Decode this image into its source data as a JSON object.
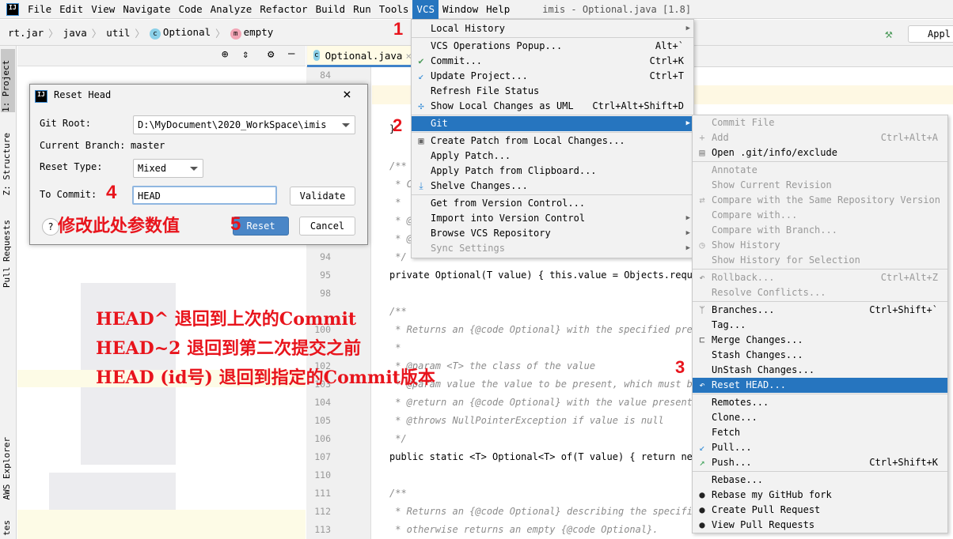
{
  "menubar": {
    "items": [
      "File",
      "Edit",
      "View",
      "Navigate",
      "Code",
      "Analyze",
      "Refactor",
      "Build",
      "Run",
      "Tools",
      "VCS",
      "Window",
      "Help"
    ],
    "active": "VCS",
    "window_title": "imis - Optional.java [1.8]"
  },
  "breadcrumb": [
    "rt.jar",
    "java",
    "util",
    "Optional",
    "empty"
  ],
  "run_config": "Appl",
  "side_tools": [
    "1: Project",
    "Z: Structure",
    "Pull Requests",
    "AWS Explorer",
    "tes"
  ],
  "editor": {
    "tab": "Optional.java",
    "lines": [
      {
        "n": "84",
        "t": ""
      },
      {
        "n": "",
        "t": "}"
      },
      {
        "n": "",
        "t": "/**"
      },
      {
        "n": "",
        "t": " * C"
      },
      {
        "n": "",
        "t": " *"
      },
      {
        "n": "",
        "t": " * @"
      },
      {
        "n": "",
        "t": " * @"
      },
      {
        "n": "94",
        "t": " */"
      },
      {
        "n": "95",
        "t": "private Optional(T value) { this.value = Objects.requir"
      },
      {
        "n": "98",
        "t": ""
      },
      {
        "n": "",
        "t": "/**"
      },
      {
        "n": "100",
        "t": " * Returns an {@code Optional} with the specified prese"
      },
      {
        "n": "",
        "t": " *"
      },
      {
        "n": "102",
        "t": " * @param <T> the class of the value"
      },
      {
        "n": "103",
        "t": " * @param value the value to be present, which must be"
      },
      {
        "n": "104",
        "t": " * @return an {@code Optional} with the value present"
      },
      {
        "n": "105",
        "t": " * @throws NullPointerException if value is null"
      },
      {
        "n": "106",
        "t": " */"
      },
      {
        "n": "107",
        "t": "public static <T> Optional<T> of(T value) { return new"
      },
      {
        "n": "110",
        "t": ""
      },
      {
        "n": "111",
        "t": "/**"
      },
      {
        "n": "112",
        "t": " * Returns an {@code Optional} describing the specifie"
      },
      {
        "n": "113",
        "t": " * otherwise returns an empty {@code Optional}."
      }
    ]
  },
  "dialog": {
    "title": "Reset Head",
    "git_root_label": "Git Root:",
    "git_root": "D:\\MyDocument\\2020_WorkSpace\\imis",
    "branch_label": "Current Branch:",
    "branch": "master",
    "reset_type_label": "Reset Type:",
    "reset_type": "Mixed",
    "commit_label": "To Commit:",
    "commit_value": "HEAD",
    "validate": "Validate",
    "reset": "Reset",
    "cancel": "Cancel",
    "help": "?"
  },
  "vcs_menu": [
    {
      "label": "Local History",
      "arrow": true
    },
    {
      "sep": true
    },
    {
      "label": "VCS Operations Popup...",
      "sc": "Alt+`"
    },
    {
      "label": "Commit...",
      "sc": "Ctrl+K",
      "icon": "check"
    },
    {
      "label": "Update Project...",
      "sc": "Ctrl+T",
      "icon": "update"
    },
    {
      "label": "Refresh File Status"
    },
    {
      "label": "Show Local Changes as UML",
      "sc": "Ctrl+Alt+Shift+D",
      "icon": "uml"
    },
    {
      "sep": true
    },
    {
      "label": "Git",
      "arrow": true,
      "sel": true
    },
    {
      "sep": true
    },
    {
      "label": "Create Patch from Local Changes...",
      "icon": "patch"
    },
    {
      "label": "Apply Patch..."
    },
    {
      "label": "Apply Patch from Clipboard..."
    },
    {
      "label": "Shelve Changes...",
      "icon": "shelve"
    },
    {
      "sep": true
    },
    {
      "label": "Get from Version Control..."
    },
    {
      "label": "Import into Version Control",
      "arrow": true
    },
    {
      "label": "Browse VCS Repository",
      "arrow": true
    },
    {
      "label": "Sync Settings",
      "arrow": true,
      "dis": true
    }
  ],
  "git_menu": [
    {
      "label": "Commit File",
      "dis": true
    },
    {
      "label": "Add",
      "sc": "Ctrl+Alt+A",
      "dis": true,
      "icon": "plus"
    },
    {
      "label": "Open .git/info/exclude",
      "icon": "file"
    },
    {
      "sep": true
    },
    {
      "label": "Annotate",
      "dis": true
    },
    {
      "label": "Show Current Revision",
      "dis": true
    },
    {
      "label": "Compare with the Same Repository Version",
      "dis": true,
      "icon": "compare"
    },
    {
      "label": "Compare with...",
      "dis": true
    },
    {
      "label": "Compare with Branch...",
      "dis": true
    },
    {
      "label": "Show History",
      "dis": true,
      "icon": "clock"
    },
    {
      "label": "Show History for Selection",
      "dis": true
    },
    {
      "sep": true
    },
    {
      "label": "Rollback...",
      "sc": "Ctrl+Alt+Z",
      "dis": true,
      "icon": "undo"
    },
    {
      "label": "Resolve Conflicts...",
      "dis": true
    },
    {
      "sep": true
    },
    {
      "label": "Branches...",
      "sc": "Ctrl+Shift+`",
      "icon": "branch"
    },
    {
      "label": "Tag..."
    },
    {
      "label": "Merge Changes...",
      "icon": "merge"
    },
    {
      "label": "Stash Changes..."
    },
    {
      "label": "UnStash Changes..."
    },
    {
      "label": "Reset HEAD...",
      "sel": true,
      "icon": "undo"
    },
    {
      "sep": true
    },
    {
      "label": "Remotes..."
    },
    {
      "label": "Clone..."
    },
    {
      "label": "Fetch"
    },
    {
      "label": "Pull...",
      "icon": "pull"
    },
    {
      "label": "Push...",
      "sc": "Ctrl+Shift+K",
      "icon": "push"
    },
    {
      "sep": true
    },
    {
      "label": "Rebase..."
    },
    {
      "label": "Rebase my GitHub fork",
      "icon": "github"
    },
    {
      "label": "Create Pull Request",
      "icon": "github"
    },
    {
      "label": "View Pull Requests",
      "icon": "github"
    }
  ],
  "annotations": {
    "n1": "1",
    "n2": "2",
    "n3": "3",
    "n4": "4",
    "n5": "5",
    "modify": "修改此处参数值",
    "l1": "HEAD^ 退回到上次的Commit",
    "l2": "HEAD~2 退回到第二次提交之前",
    "l3": "HEAD (id号) 退回到指定的Commit版本"
  },
  "colors": {
    "accent": "#2675bf",
    "annotation": "#e8141c"
  }
}
